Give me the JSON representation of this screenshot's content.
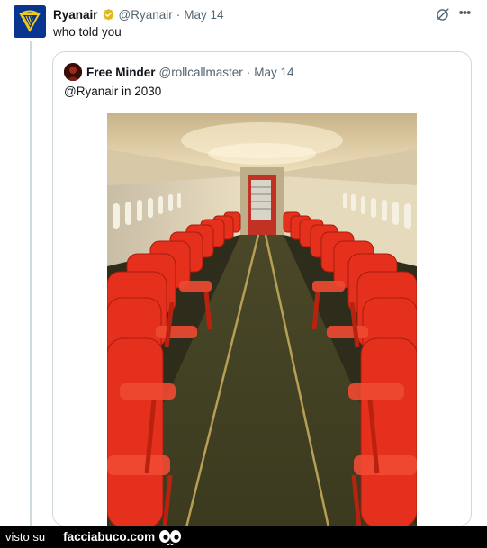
{
  "tweet": {
    "author_name": "Ryanair",
    "author_handle": "@Ryanair",
    "separator": "·",
    "date": "May 14",
    "text": "who told you",
    "avatar_icon": "ryanair-harp-logo",
    "verified_icon": "gold-verified-badge",
    "actions_icons": [
      "grok-icon",
      "more-icon"
    ]
  },
  "quote": {
    "author_name": "Free Minder",
    "author_handle": "@rollcallmaster",
    "separator": "·",
    "date": "May 14",
    "text": "@Ryanair in 2030",
    "image_description_icon": "airplane-cabin-red-plastic-chairs-image"
  },
  "footer": {
    "visto_label": "visto su",
    "site_label": "facciabuco.com",
    "eyes_icon": "eyes-icon"
  },
  "colors": {
    "ryanair_blue": "#073590",
    "ryanair_gold": "#f1c917",
    "chair_red": "#e4301c",
    "text_primary": "#0f1419",
    "text_secondary": "#536471",
    "border": "#cfd9de",
    "footer_bg": "#000000"
  }
}
